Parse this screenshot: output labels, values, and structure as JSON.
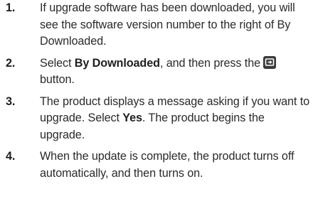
{
  "steps": [
    {
      "number": "1.",
      "text": "If upgrade software has been downloaded, you will see the software version number to the right of By Downloaded."
    },
    {
      "number": "2.",
      "prefix": "Select ",
      "bold": "By Downloaded",
      "middle": ", and then press the ",
      "icon": "enter-button-icon",
      "suffix": " button."
    },
    {
      "number": "3.",
      "prefix": "The product displays a message asking if you want to upgrade. Select ",
      "bold": "Yes",
      "suffix": ". The product begins the upgrade."
    },
    {
      "number": "4.",
      "text": "When the update is complete, the product turns off automatically, and then turns on."
    }
  ]
}
